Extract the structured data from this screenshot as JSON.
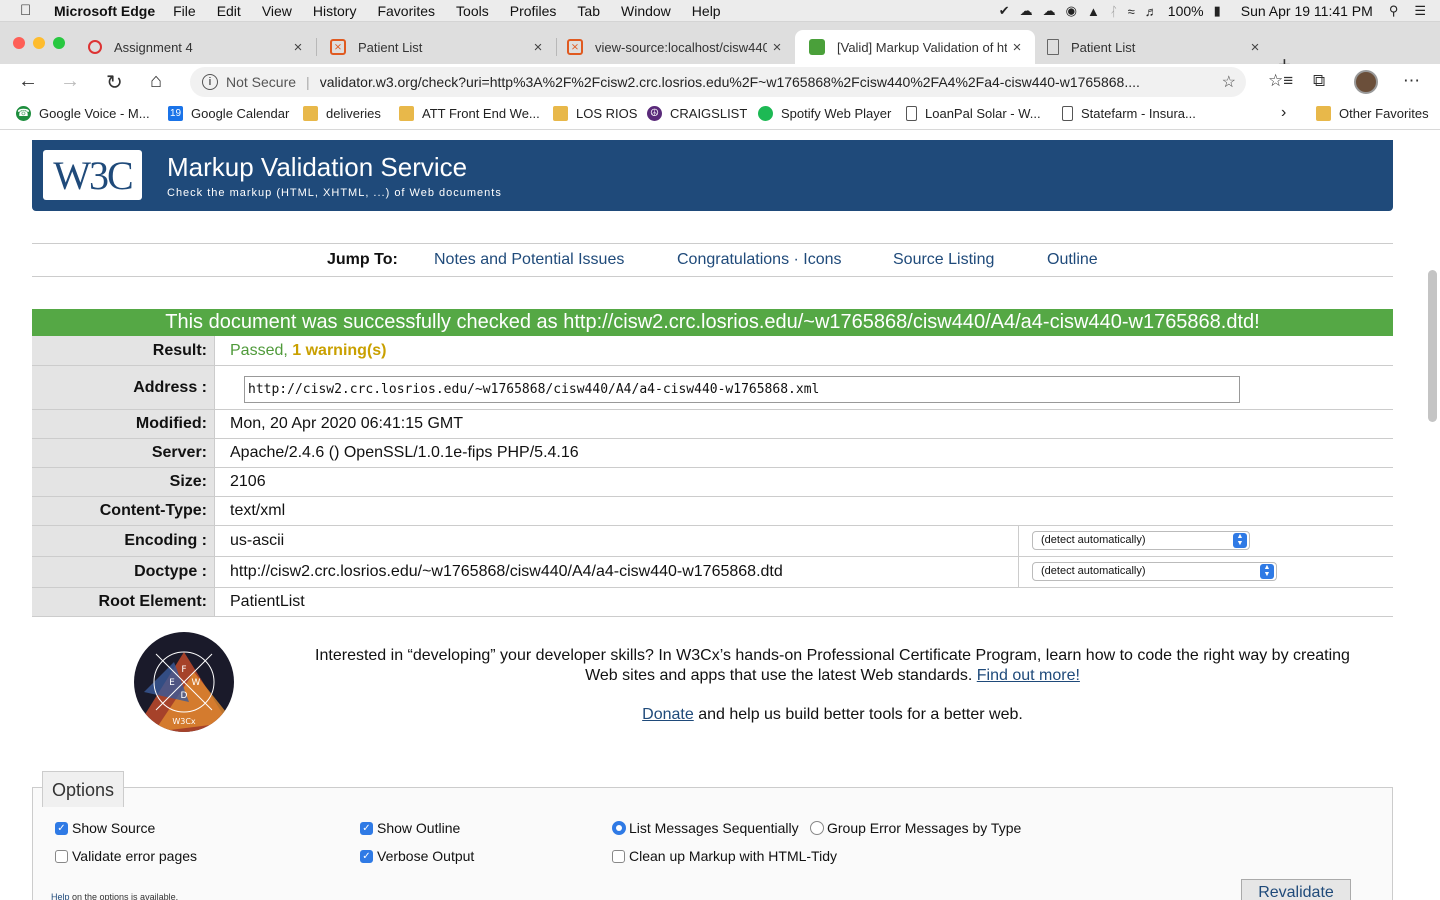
{
  "menubar": {
    "app_name": "Microsoft Edge",
    "items": [
      "File",
      "Edit",
      "View",
      "History",
      "Favorites",
      "Tools",
      "Profiles",
      "Tab",
      "Window",
      "Help"
    ],
    "battery": "100%",
    "clock": "Sun Apr 19  11:41 PM"
  },
  "tabs": [
    {
      "title": "Assignment 4",
      "icon": "spinner-icon",
      "active": false
    },
    {
      "title": "Patient List",
      "icon": "xml-icon",
      "active": false
    },
    {
      "title": "view-source:localhost/cisw440",
      "icon": "xml-icon",
      "active": false
    },
    {
      "title": "[Valid] Markup Validation of ht",
      "icon": "w3c-green-icon",
      "active": true
    },
    {
      "title": "Patient List",
      "icon": "page-icon",
      "active": false
    }
  ],
  "address_bar": {
    "security": "Not Secure",
    "url": "validator.w3.org/check?uri=http%3A%2F%2Fcisw2.crc.losrios.edu%2F~w1765868%2Fcisw440%2FA4%2Fa4-cisw440-w1765868...."
  },
  "favorites": [
    {
      "label": "Google Voice - M...",
      "icon": "google-voice-icon"
    },
    {
      "label": "Google Calendar",
      "icon": "calendar-icon"
    },
    {
      "label": "deliveries",
      "icon": "folder-icon"
    },
    {
      "label": "ATT Front End We...",
      "icon": "folder-icon"
    },
    {
      "label": "LOS RIOS",
      "icon": "folder-icon"
    },
    {
      "label": "CRAIGSLIST",
      "icon": "peace-icon"
    },
    {
      "label": "Spotify Web Player",
      "icon": "spotify-icon"
    },
    {
      "label": "LoanPal Solar - W...",
      "icon": "page-icon"
    },
    {
      "label": "Statefarm - Insura...",
      "icon": "page-icon"
    }
  ],
  "other_favorites": "Other Favorites",
  "banner": {
    "logo_text": "W3C",
    "title": "Markup Validation Service",
    "subtitle": "Check the markup (HTML, XHTML, ...) of Web documents"
  },
  "jump": {
    "label": "Jump To:",
    "links": [
      "Notes and Potential Issues",
      "Congratulations · Icons",
      "Source Listing",
      "Outline"
    ]
  },
  "success_message": "This document was successfully checked as http://cisw2.crc.losrios.edu/~w1765868/cisw440/A4/a4-cisw440-w1765868.dtd!",
  "results": {
    "result_label": "Result:",
    "result_passed": "Passed,",
    "result_warnings": "1 warning(s)",
    "address_label": "Address :",
    "address_value": "http://cisw2.crc.losrios.edu/~w1765868/cisw440/A4/a4-cisw440-w1765868.xml",
    "modified_label": "Modified:",
    "modified_value": "Mon, 20 Apr 2020 06:41:15 GMT",
    "server_label": "Server:",
    "server_value": "Apache/2.4.6 () OpenSSL/1.0.1e-fips PHP/5.4.16",
    "size_label": "Size:",
    "size_value": "2106",
    "content_type_label": "Content-Type:",
    "content_type_value": "text/xml",
    "encoding_label": "Encoding :",
    "encoding_value": "us-ascii",
    "encoding_select": "(detect automatically)",
    "doctype_label": "Doctype :",
    "doctype_value": "http://cisw2.crc.losrios.edu/~w1765868/cisw440/A4/a4-cisw440-w1765868.dtd",
    "doctype_select": "(detect automatically)",
    "root_label": "Root Element:",
    "root_value": "PatientList"
  },
  "promo": {
    "text_before": "Interested in “developing” your developer skills? In W3Cx’s hands-on Professional Certificate Program, learn how to code the right way by creating Web sites and apps that use the latest Web standards.",
    "link": "Find out more!",
    "donate_link": "Donate",
    "donate_text": " and help us build better tools for a better web."
  },
  "options": {
    "legend": "Options",
    "show_source": "Show Source",
    "show_outline": "Show Outline",
    "list_sequential": "List Messages Sequentially",
    "group_errors": "Group Error Messages by Type",
    "validate_error_pages": "Validate error pages",
    "verbose_output": "Verbose Output",
    "clean_up": "Clean up Markup with HTML-Tidy",
    "help_link": "Help",
    "help_text": " on the options is available.",
    "revalidate": "Revalidate"
  },
  "colors": {
    "banner_blue": "#1f4a7a",
    "success_green": "#55a845",
    "warning_gold": "#c9a000",
    "passed_green": "#4f9a3a",
    "checkbox_blue": "#2f7ae5"
  }
}
